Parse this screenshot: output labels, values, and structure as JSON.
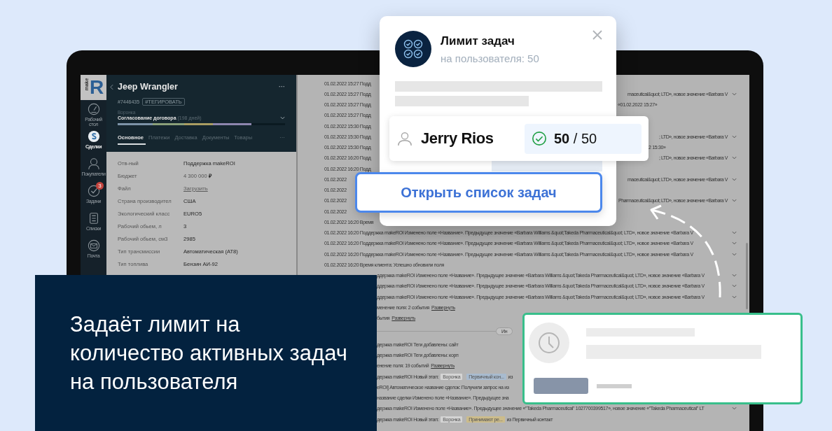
{
  "app": {
    "logo": {
      "word": "make",
      "letter": "R"
    },
    "nav": [
      {
        "kind": "gauge",
        "label": "Рабочий стол",
        "selected": false
      },
      {
        "kind": "dollar",
        "label": "Сделки",
        "selected": true
      },
      {
        "kind": "person",
        "label": "Покупатели",
        "selected": false
      },
      {
        "kind": "check",
        "label": "Задачи",
        "selected": false,
        "badge": "3"
      },
      {
        "kind": "list",
        "label": "Списки",
        "selected": false
      },
      {
        "kind": "mail",
        "label": "Почта",
        "selected": false
      }
    ],
    "deal": {
      "title": "Jeep Wrangler",
      "more": "···",
      "number": "#7446435",
      "tag": "#ТЕГИРОВАТЬ",
      "funnel_label": "Воронка",
      "stage": "Согласование договора",
      "stage_days": "(198 дней)",
      "level": 0.8,
      "tabs": [
        {
          "label": "Основное",
          "selected": true
        },
        {
          "label": "Платежи",
          "selected": false
        },
        {
          "label": "Доставка",
          "selected": false
        },
        {
          "label": "Документы",
          "selected": false
        },
        {
          "label": "Товары",
          "selected": false
        }
      ],
      "tabs_more": "···",
      "fields": [
        {
          "label": "Отв-ный",
          "value": "Поддержка makeROI",
          "kind": "text"
        },
        {
          "label": "Бюджет",
          "value": "4 300 000",
          "currency": "₽",
          "kind": "money"
        },
        {
          "label": "Файл",
          "value": "Загрузить",
          "kind": "link"
        },
        {
          "label": "Страна производител",
          "value": "США",
          "kind": "text"
        },
        {
          "label": "Экологический класс",
          "value": "EURO5",
          "kind": "text"
        },
        {
          "label": "Рабочий обьем, л",
          "value": "3",
          "kind": "text"
        },
        {
          "label": "Рабочий обьем, см3",
          "value": "2985",
          "kind": "text"
        },
        {
          "label": "Тип трансмиссии",
          "value": "Автоматическая (AT8)",
          "kind": "text"
        },
        {
          "label": "Тип топлива",
          "value": "Бензин АИ-92",
          "kind": "text"
        }
      ]
    },
    "feed": {
      "top_rows": [
        {
          "parts": [
            {
              "kind": "text",
              "text": "01.02.2022 15:27 Подд"
            }
          ],
          "chevron": false
        },
        {
          "parts": [
            {
              "kind": "text",
              "text": "01.02.2022 15:27 Подд"
            }
          ],
          "right": "maceutical&quot; LTD», новое значение «Barbara V",
          "chevron": true
        },
        {
          "parts": [
            {
              "kind": "text",
              "text": "01.02.2022 15:27 Подд"
            }
          ],
          "right": "«01.02.2022 15:27»",
          "chevron": false
        },
        {
          "parts": [
            {
              "kind": "text",
              "text": "01.02.2022 15:27 Подд"
            }
          ],
          "chevron": false
        },
        {
          "parts": [
            {
              "kind": "text",
              "text": "01.02.2022 15:30 Подд"
            }
          ],
          "chevron": false
        },
        {
          "parts": [
            {
              "kind": "text",
              "text": "01.02.2022 15:30 Подд"
            }
          ],
          "right": "; LTD», новое значение «Barbara V",
          "chevron": true
        },
        {
          "parts": [
            {
              "kind": "text",
              "text": "01.02.2022 15:30 Подд"
            }
          ],
          "right": "2 15:30»",
          "chevron": false
        },
        {
          "parts": [
            {
              "kind": "text",
              "text": "01.02.2022 16:20 Подд"
            }
          ],
          "right": "; LTD», новое значение «Barbara V",
          "chevron": true
        },
        {
          "parts": [
            {
              "kind": "text",
              "text": "01.02.2022 16:20 Подд"
            }
          ],
          "chevron": false
        },
        {
          "parts": [
            {
              "kind": "text",
              "text": "01.02.2022"
            }
          ],
          "right": "maceutical&quot; LTD», новое значение «Barbara V",
          "chevron": true
        },
        {
          "parts": [
            {
              "kind": "text",
              "text": "01.02.2022"
            }
          ],
          "chevron": false
        },
        {
          "parts": [
            {
              "kind": "text",
              "text": "01.02.2022"
            }
          ],
          "right": "Pharmaceutical&quot; LTD», новое значение «Barbara V",
          "chevron": true
        },
        {
          "parts": [
            {
              "kind": "text",
              "text": "01.02.2022"
            }
          ],
          "chevron": false
        },
        {
          "parts": [
            {
              "kind": "text",
              "text": "01.02.2022 16:20 Время"
            }
          ],
          "chevron": false
        }
      ],
      "full_rows": [
        {
          "parts": [
            {
              "kind": "text",
              "text": "01.02.2022 16:20 Поддержка makeROI Изменено поле «Название». Предыдущее значение «Barbara Williams &quot;Takeda Pharmaceutical&quot; LTD», новое значение «Barbara V"
            }
          ],
          "chevron": true
        },
        {
          "parts": [
            {
              "kind": "text",
              "text": "01.02.2022 16:20 Поддержка makeROI Изменено поле «Название». Предыдущее значение «Barbara Williams &quot;Takeda Pharmaceutical&quot; LTD», новое значение «Barbara V"
            }
          ],
          "chevron": true
        },
        {
          "parts": [
            {
              "kind": "text",
              "text": "01.02.2022 16:20 Поддержка makeROI Изменено поле «Название». Предыдущее значение «Barbara Williams &quot;Takeda Pharmaceutical&quot; LTD», новое значение «Barbara V"
            }
          ],
          "chevron": true
        },
        {
          "parts": [
            {
              "kind": "text",
              "text": "01.02.2022 16:20 Время клиента: Успешно обновили поля"
            }
          ],
          "chevron": false
        }
      ],
      "lower_items": [
        {
          "kind": "row",
          "parts": [
            {
              "kind": "text",
              "text": "ддержка makeROI Изменено поле «Название». Предыдущее значение «Barbara Williams &quot;Takeda Pharmaceutical&quot; LTD», новое значение «Barbara V"
            }
          ],
          "chevron": true
        },
        {
          "kind": "row",
          "parts": [
            {
              "kind": "text",
              "text": "ддержка makeROI Изменено поле «Название». Предыдущее значение «Barbara Williams &quot;Takeda Pharmaceutical&quot; LTD», новое значение «Barbara V"
            }
          ],
          "chevron": true
        },
        {
          "kind": "row",
          "parts": [
            {
              "kind": "text",
              "text": "ддержка makeROI Изменено поле «Название». Предыдущее значение «Barbara Williams &quot;Takeda Pharmaceutical&quot; LTD», новое значение «Barbara V"
            }
          ],
          "chevron": true
        },
        {
          "kind": "row",
          "parts": [
            {
              "kind": "text",
              "text": "менение поля: 2 события"
            },
            {
              "kind": "link",
              "text": "Развернуть"
            }
          ],
          "chevron": false
        },
        {
          "kind": "row",
          "parts": [
            {
              "kind": "text",
              "text": "бытия"
            },
            {
              "kind": "link",
              "text": "Развернуть"
            }
          ],
          "chevron": false
        },
        {
          "kind": "divider",
          "label": "Ин"
        },
        {
          "kind": "row",
          "parts": [
            {
              "kind": "text",
              "text": "держка makeROI Теги добавлены: сайт"
            }
          ],
          "chevron": false
        },
        {
          "kind": "row",
          "parts": [
            {
              "kind": "text",
              "text": "держка makeROI Теги добавлены: корп"
            }
          ],
          "chevron": false
        },
        {
          "kind": "row",
          "parts": [
            {
              "kind": "text",
              "text": "енение поля: 19 событий"
            },
            {
              "kind": "link",
              "text": "Развернуть"
            }
          ],
          "chevron": false
        },
        {
          "kind": "row",
          "parts": [
            {
              "kind": "text",
              "text": "держка makeROI Новый этап:"
            },
            {
              "kind": "tag",
              "text": "Воронка",
              "color": "#d4d4d4"
            },
            {
              "kind": "tag",
              "text": "Первичный кон...",
              "color": "#a8bbcf"
            },
            {
              "kind": "text",
              "text": "из"
            }
          ],
          "chevron": false
        },
        {
          "kind": "row",
          "parts": [
            {
              "kind": "text",
              "text": "eROI] Автоматическое название сделок: Получили запрос на из"
            }
          ],
          "chevron": false
        },
        {
          "kind": "row",
          "parts": [
            {
              "kind": "text",
              "text": "название сделки Изменено поле «Название». Предыдущее зна"
            }
          ],
          "chevron": false
        },
        {
          "kind": "row",
          "parts": [
            {
              "kind": "text",
              "text": "держка makeROI Изменено поле «Название». Предыдущее значение «\"Takeda Pharmaceutical\" 1027700399517», новое значение «\"Takeda Pharmaceutical\" LT"
            }
          ],
          "chevron": true
        },
        {
          "kind": "row",
          "parts": [
            {
              "kind": "text",
              "text": "держка makeROI Новый этап:"
            },
            {
              "kind": "tag",
              "text": "Воронка",
              "color": "#d4d4d4"
            },
            {
              "kind": "tag",
              "text": "Принимают ре...",
              "color": "#ccbc8b"
            },
            {
              "kind": "text",
              "text": "из Первичный контакт"
            }
          ],
          "chevron": false
        }
      ]
    }
  },
  "popup": {
    "title": "Лимит задач",
    "subtitle": "на пользователя: 50",
    "user": {
      "name": "Jerry Rios",
      "count": "**50** / 50"
    },
    "button": "Открыть список задач"
  },
  "headline": "Задаёт лимит на количество активных задач на пользователя"
}
